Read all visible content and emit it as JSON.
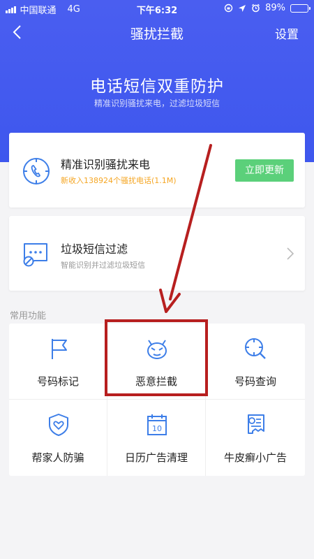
{
  "status_bar": {
    "carrier": "中国联通",
    "network": "4G",
    "time": "下午6:32",
    "battery": "89%",
    "battery_level": 0.89
  },
  "nav": {
    "title": "骚扰拦截",
    "settings_label": "设置"
  },
  "hero": {
    "title": "电话短信双重防护",
    "subtitle": "精准识别骚扰来电，过滤垃圾短信"
  },
  "call_card": {
    "title": "精准识别骚扰来电",
    "subtitle": "新收入138924个骚扰电话(1.1M)",
    "button_label": "立即更新"
  },
  "sms_card": {
    "title": "垃圾短信过滤",
    "subtitle": "智能识别并过滤垃圾短信"
  },
  "section_label": "常用功能",
  "features": [
    {
      "label": "号码标记",
      "icon": "flag-icon"
    },
    {
      "label": "恶意拦截",
      "icon": "devil-face-icon"
    },
    {
      "label": "号码查询",
      "icon": "magnifier-crosshair-icon"
    },
    {
      "label": "帮家人防骗",
      "icon": "heart-shield-icon"
    },
    {
      "label": "日历广告清理",
      "icon": "calendar-icon"
    },
    {
      "label": "牛皮癣小广告",
      "icon": "flyer-ad-icon"
    }
  ],
  "colors": {
    "brand_blue": "#3e57ee",
    "accent_orange": "#f5a623",
    "update_green": "#5bd07a",
    "icon_blue": "#3d7ee8",
    "annotation_red": "#b71f1f"
  }
}
